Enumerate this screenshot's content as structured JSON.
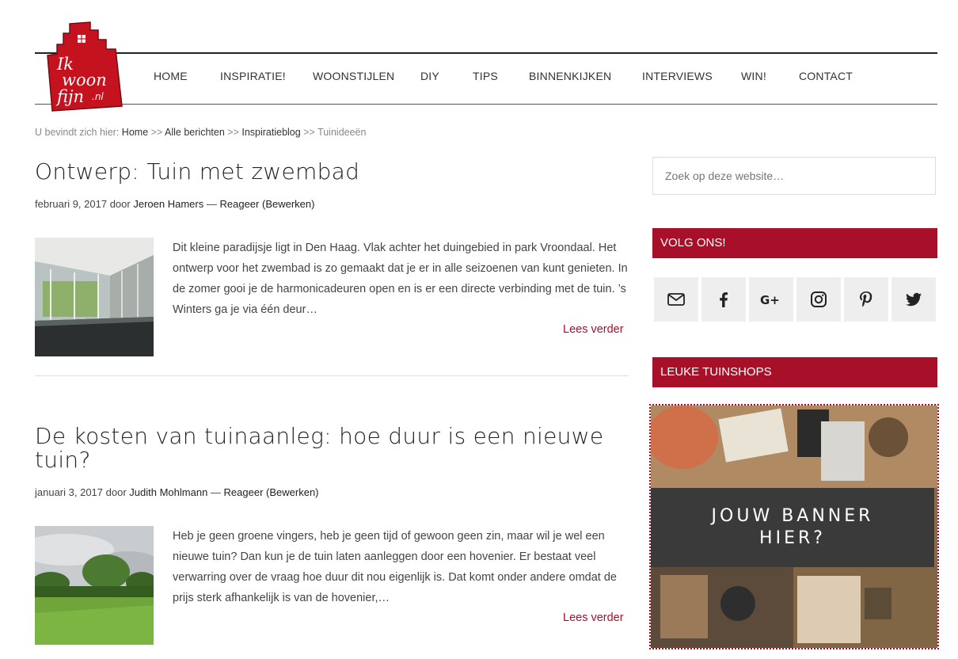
{
  "site": {
    "logo_text": "Ik woon fijn.nl"
  },
  "nav": [
    "HOME",
    "INSPIRATIE!",
    "WOONSTIJLEN",
    "DIY",
    "TIPS",
    "BINNENKIJKEN",
    "INTERVIEWS",
    "WIN!",
    "CONTACT"
  ],
  "breadcrumb": {
    "prefix": "U bevindt zich hier:",
    "items": [
      "Home",
      "Alle berichten",
      "Inspiratieblog"
    ],
    "separator": ">>",
    "current": "Tuinideeën"
  },
  "posts": [
    {
      "title": "Ontwerp: Tuin met zwembad",
      "date": "februari 9, 2017",
      "by": "door",
      "author": "Jeroen Hamers",
      "dash": "—",
      "reply": "Reageer",
      "edit": "(Bewerken)",
      "excerpt": "Dit kleine paradijsje ligt in Den Haag. Vlak achter het duingebied in park Vroondaal. Het ontwerp voor het zwembad is zo gemaakt dat je er in alle seizoenen van kunt genieten. In de zomer gooi je de harmonicadeuren open en is er een directe verbinding met de tuin. ’s Winters ga je via één deur…",
      "read_more": "Lees verder"
    },
    {
      "title": "De kosten van tuinaanleg: hoe duur is een nieuwe tuin?",
      "date": "januari 3, 2017",
      "by": "door",
      "author": "Judith Mohlmann",
      "dash": "—",
      "reply": "Reageer",
      "edit": "(Bewerken)",
      "excerpt": "Heb je geen groene vingers, heb je geen tijd of gewoon geen zin, maar wil je wel een nieuwe tuin? Dan kun je de tuin laten aanleggen door een hovenier. Er bestaat veel verwarring over de vraag hoe duur dit nou eigenlijk is. Dat komt onder andere omdat de prijs sterk afhankelijk is van de hovenier,…",
      "read_more": "Lees verder"
    }
  ],
  "sidebar": {
    "search_placeholder": "Zoek op deze website…",
    "follow_title": "VOLG ONS!",
    "social_icons": [
      "mail-icon",
      "facebook-icon",
      "google-plus-icon",
      "instagram-icon",
      "pinterest-icon",
      "twitter-icon"
    ],
    "shops_title": "LEUKE TUINSHOPS",
    "banner_line1": "JOUW BANNER",
    "banner_line2": "HIER?"
  },
  "colors": {
    "accent": "#a8102a",
    "text": "#333333",
    "social_bg": "#eeeeee"
  }
}
